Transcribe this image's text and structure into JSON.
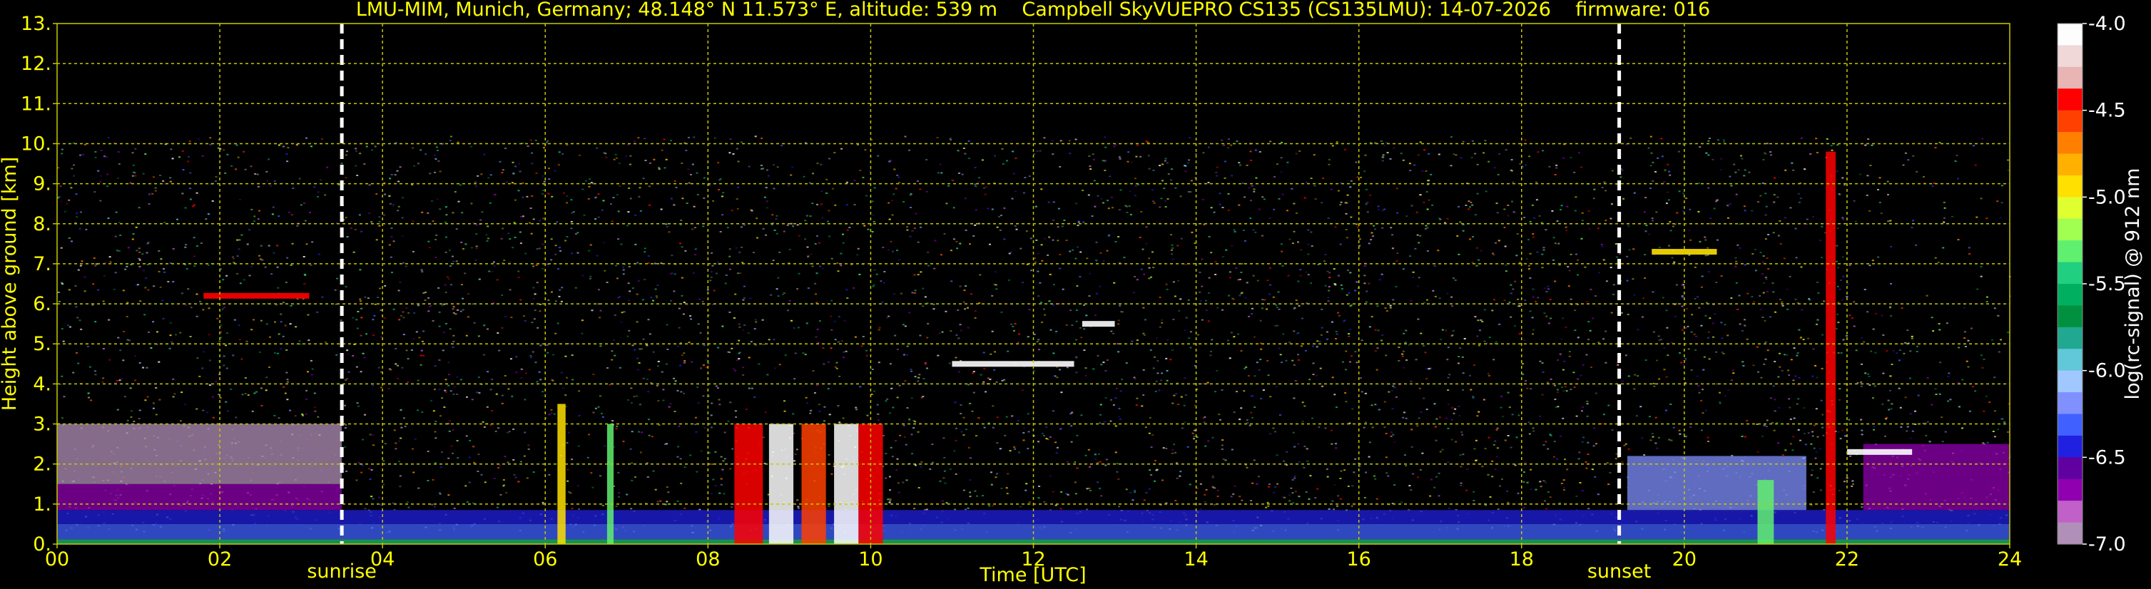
{
  "chart_data": {
    "type": "heatmap",
    "title": "LMU-MIM, Munich, Germany; 48.148° N 11.573° E, altitude: 539 m    Campbell SkyVUEPRO CS135 (CS135LMU): 14-07-2026    firmware: 016",
    "xlabel": "Time [UTC]",
    "ylabel": "Height above ground [km]",
    "colorbar_label": "log(rc-signal) @ 912 nm",
    "xlim": [
      0,
      24
    ],
    "ylim": [
      0,
      13
    ],
    "xticks": [
      "00",
      "02",
      "04",
      "06",
      "08",
      "10",
      "12",
      "14",
      "16",
      "18",
      "20",
      "22",
      "24"
    ],
    "yticks": [
      "0.",
      "1.",
      "2.",
      "3.",
      "4.",
      "5.",
      "6.",
      "7.",
      "8.",
      "9.",
      "10.",
      "11.",
      "12.",
      "13."
    ],
    "colorbar_ticks": [
      "-4.0",
      "-4.5",
      "-5.0",
      "-5.5",
      "-6.0",
      "-6.5",
      "-7.0"
    ],
    "colorbar_range": [
      -7.0,
      -4.0
    ],
    "grid": true,
    "events": [
      {
        "label": "sunrise",
        "time": 3.5
      },
      {
        "label": "sunset",
        "time": 19.2
      }
    ],
    "colormap": [
      "#fdfdfd",
      "#f0d8d8",
      "#e8b4b4",
      "#ff0000",
      "#ff4000",
      "#ff8000",
      "#ffb000",
      "#ffe000",
      "#e0ff30",
      "#a0ff50",
      "#60f070",
      "#20d080",
      "#00b060",
      "#009040",
      "#20a890",
      "#60c8d8",
      "#a0c8ff",
      "#8090ff",
      "#4060ff",
      "#2020e0",
      "#6000a0",
      "#9000b0",
      "#c060c8",
      "#b090b8"
    ],
    "background_color": "#000000",
    "text_color": "#ffff00",
    "grid_color": "#c8c800"
  }
}
